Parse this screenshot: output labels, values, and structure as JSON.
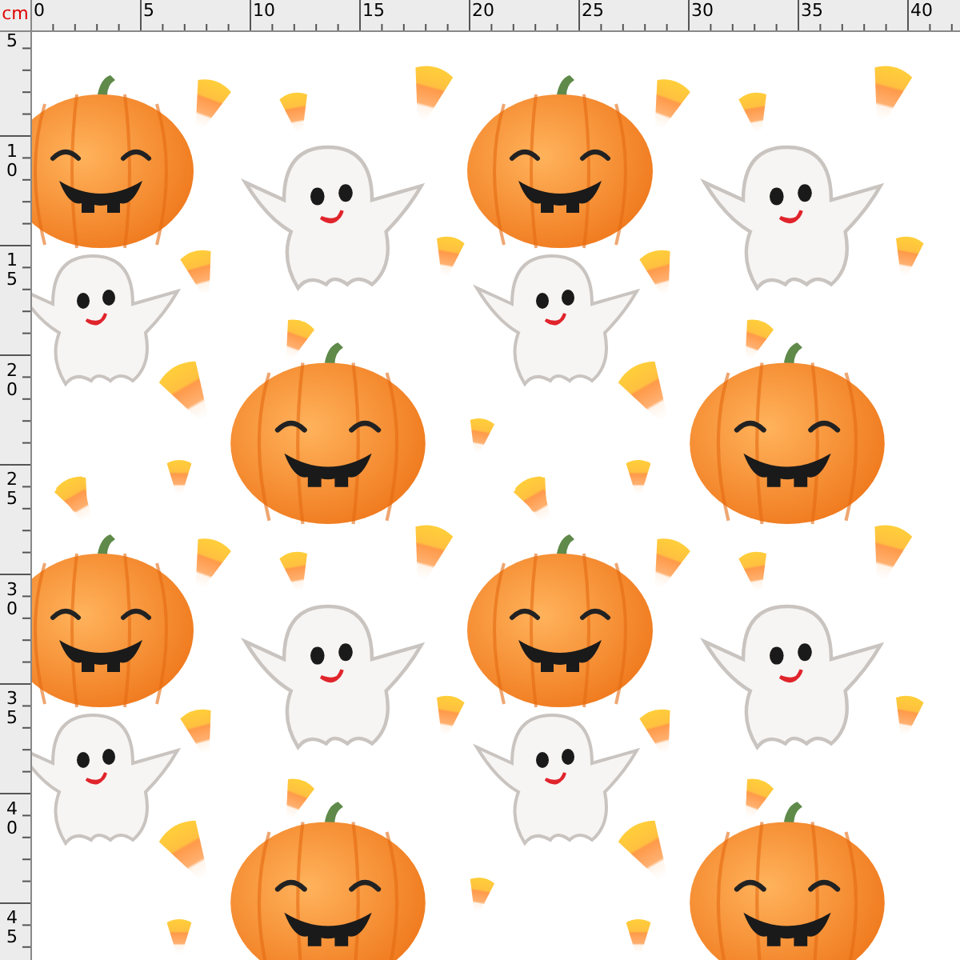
{
  "ruler": {
    "unit": "cm",
    "horizontal_labels": [
      "0",
      "5",
      "10",
      "15",
      "20",
      "25",
      "30",
      "35",
      "40"
    ],
    "vertical_labels": [
      "5",
      "10",
      "15",
      "20",
      "25",
      "30",
      "35",
      "40",
      "45"
    ]
  }
}
